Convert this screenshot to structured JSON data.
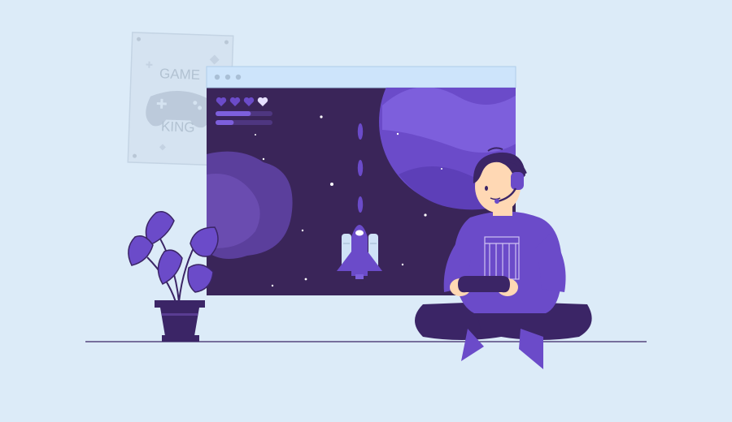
{
  "poster": {
    "line1": "GAME",
    "line2": "KING"
  },
  "game": {
    "lives": {
      "filled": 3,
      "total": 4
    },
    "bars": [
      {
        "level": 0.62
      },
      {
        "level": 0.32
      }
    ]
  },
  "colors": {
    "background": "#dcebf8",
    "window_bar": "#cde4fb",
    "space": "#3a2559",
    "accent": "#6b4bc9",
    "dark_purple": "#3b2566",
    "skin": "#ffd8b4"
  }
}
